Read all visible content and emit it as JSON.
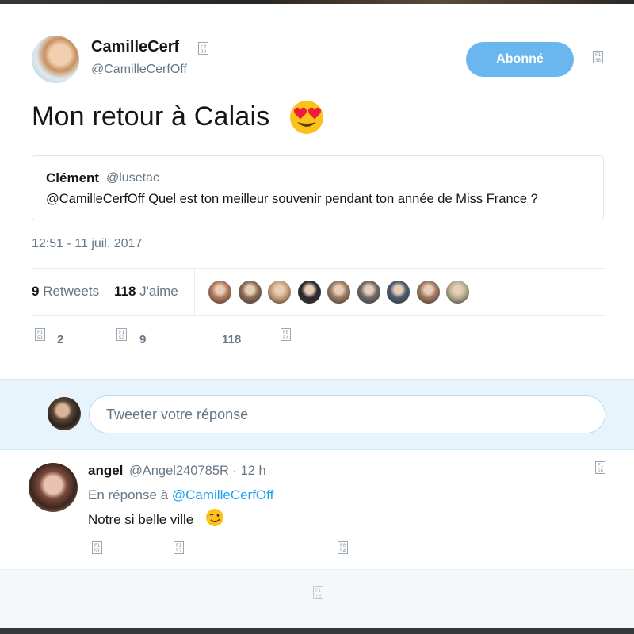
{
  "tweet": {
    "author_name": "CamilleCerf",
    "verified_glyph": "F0\n99",
    "author_handle": "@CamilleCerfOff",
    "follow_label": "Abonné",
    "caret_glyph": "F1\n56",
    "text": "Mon retour à Calais",
    "emoji": "heart-eyes-emoji",
    "quote": {
      "name": "Clément",
      "handle": "@lusetac",
      "text": "@CamilleCerfOff Quel est ton meilleur souvenir pendant ton année de Miss France ?"
    },
    "timestamp": "12:51 - 11 juil. 2017",
    "stats": {
      "retweets_count": "9",
      "retweets_label": "Retweets",
      "likes_count": "118",
      "likes_label": "J'aime"
    },
    "actions": {
      "reply_glyph": "F1\n51",
      "reply_count": "2",
      "retweet_glyph": "F1\n52",
      "retweet_count": "9",
      "like_count": "118",
      "dm_glyph": "F0\n54"
    }
  },
  "reply_composer": {
    "placeholder": "Tweeter votre réponse"
  },
  "reply": {
    "name": "angel",
    "handle_time": "@Angel240785R · 12 h",
    "caret_glyph": "F1\n56",
    "reply_to_prefix": "En réponse à",
    "reply_to_handle": "@CamilleCerfOff",
    "text": "Notre si belle ville",
    "emoji": "wink-emoji",
    "actions": {
      "reply_glyph": "F1\n51",
      "retweet_glyph": "F1\n52",
      "dm_glyph": "F0\n54"
    }
  },
  "footer": {
    "loader_glyph": "F1\n78"
  },
  "colors": {
    "accent": "#1da1f2",
    "follow_button": "#6ab7f0",
    "muted": "#657786",
    "composer_bg": "#e8f4fb"
  },
  "likers": [
    "#b07a5a",
    "#8a6a55",
    "#c8a27a",
    "#2a2a30",
    "#9a7a60",
    "#6a6a6a",
    "#4a5a70",
    "#a07860",
    "#b8b090"
  ]
}
